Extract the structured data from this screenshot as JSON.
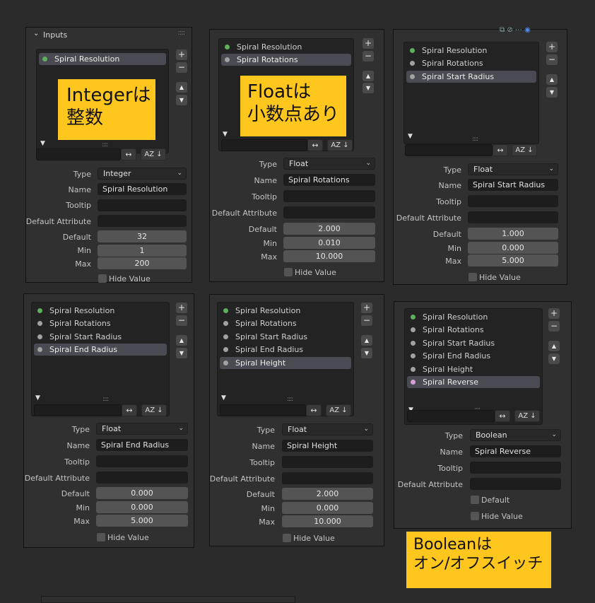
{
  "panels": [
    {
      "header_title": "Inputs",
      "items": [
        {
          "label": "Spiral Resolution",
          "dot": "green",
          "selected": true
        }
      ],
      "props": {
        "type_label": "Type",
        "type_value": "Integer",
        "name_label": "Name",
        "name_value": "Spiral Resolution",
        "tooltip_label": "Tooltip",
        "tooltip_value": "",
        "default_attr_label": "Default Attribute",
        "default_attr_value": "",
        "default_label": "Default",
        "default_value": "32",
        "min_label": "Min",
        "min_value": "1",
        "max_label": "Max",
        "max_value": "200",
        "hide_label": "Hide Value"
      },
      "note_lines": [
        "Integerは",
        "整数"
      ]
    },
    {
      "items": [
        {
          "label": "Spiral Resolution",
          "dot": "green",
          "selected": false
        },
        {
          "label": "Spiral Rotations",
          "dot": "gray",
          "selected": true
        }
      ],
      "props": {
        "type_label": "Type",
        "type_value": "Float",
        "name_label": "Name",
        "name_value": "Spiral Rotations",
        "tooltip_label": "Tooltip",
        "tooltip_value": "",
        "default_attr_label": "Default Attribute",
        "default_attr_value": "",
        "default_label": "Default",
        "default_value": "2.000",
        "min_label": "Min",
        "min_value": "0.010",
        "max_label": "Max",
        "max_value": "10.000",
        "hide_label": "Hide Value"
      },
      "note_lines": [
        "Floatは",
        "小数点あり"
      ]
    },
    {
      "items": [
        {
          "label": "Spiral Resolution",
          "dot": "green",
          "selected": false
        },
        {
          "label": "Spiral Rotations",
          "dot": "gray",
          "selected": false
        },
        {
          "label": "Spiral Start Radius",
          "dot": "gray",
          "selected": true
        }
      ],
      "props": {
        "type_label": "Type",
        "type_value": "Float",
        "name_label": "Name",
        "name_value": "Spiral Start Radius",
        "tooltip_label": "Tooltip",
        "tooltip_value": "",
        "default_attr_label": "Default Attribute",
        "default_attr_value": "",
        "default_label": "Default",
        "default_value": "1.000",
        "min_label": "Min",
        "min_value": "0.000",
        "max_label": "Max",
        "max_value": "5.000",
        "hide_label": "Hide Value"
      }
    },
    {
      "items": [
        {
          "label": "Spiral Resolution",
          "dot": "green",
          "selected": false
        },
        {
          "label": "Spiral Rotations",
          "dot": "gray",
          "selected": false
        },
        {
          "label": "Spiral Start Radius",
          "dot": "gray",
          "selected": false
        },
        {
          "label": "Spiral End Radius",
          "dot": "gray",
          "selected": true
        }
      ],
      "props": {
        "type_label": "Type",
        "type_value": "Float",
        "name_label": "Name",
        "name_value": "Spiral End Radius",
        "tooltip_label": "Tooltip",
        "tooltip_value": "",
        "default_attr_label": "Default Attribute",
        "default_attr_value": "",
        "default_label": "Default",
        "default_value": "0.000",
        "min_label": "Min",
        "min_value": "0.000",
        "max_label": "Max",
        "max_value": "5.000",
        "hide_label": "Hide Value"
      }
    },
    {
      "items": [
        {
          "label": "Spiral Resolution",
          "dot": "green",
          "selected": false
        },
        {
          "label": "Spiral Rotations",
          "dot": "gray",
          "selected": false
        },
        {
          "label": "Spiral Start Radius",
          "dot": "gray",
          "selected": false
        },
        {
          "label": "Spiral End Radius",
          "dot": "gray",
          "selected": false
        },
        {
          "label": "Spiral Height",
          "dot": "gray",
          "selected": true
        }
      ],
      "props": {
        "type_label": "Type",
        "type_value": "Float",
        "name_label": "Name",
        "name_value": "Spiral Height",
        "tooltip_label": "Tooltip",
        "tooltip_value": "",
        "default_attr_label": "Default Attribute",
        "default_attr_value": "",
        "default_label": "Default",
        "default_value": "2.000",
        "min_label": "Min",
        "min_value": "0.000",
        "max_label": "Max",
        "max_value": "10.000",
        "hide_label": "Hide Value"
      }
    },
    {
      "items": [
        {
          "label": "Spiral Resolution",
          "dot": "green",
          "selected": false
        },
        {
          "label": "Spiral Rotations",
          "dot": "gray",
          "selected": false
        },
        {
          "label": "Spiral Start Radius",
          "dot": "gray",
          "selected": false
        },
        {
          "label": "Spiral End Radius",
          "dot": "gray",
          "selected": false
        },
        {
          "label": "Spiral Height",
          "dot": "gray",
          "selected": false
        },
        {
          "label": "Spiral Reverse",
          "dot": "pink",
          "selected": true
        }
      ],
      "props": {
        "type_label": "Type",
        "type_value": "Boolean",
        "name_label": "Name",
        "name_value": "Spiral Reverse",
        "tooltip_label": "Tooltip",
        "tooltip_value": "",
        "default_attr_label": "Default Attribute",
        "default_attr_value": "",
        "default_check_label": "Default",
        "hide_label": "Hide Value"
      }
    }
  ],
  "bool_note_lines": [
    "Booleanは",
    "オン/オフスイッチ"
  ],
  "icons": {
    "add": "+",
    "remove": "−",
    "move_up": "▲",
    "move_down": "▼",
    "collapse": "▼",
    "grip": "::::",
    "swap": "↔",
    "sort_az": "AZ",
    "sort_dir": "↓",
    "chevron": "⌄"
  },
  "colors": {
    "panel_bg": "#303030",
    "list_bg": "#232323",
    "selected_row": "#4a4b52",
    "note_bg": "#ffc61e",
    "socket_int": "#5faf5f",
    "socket_float": "#a1a1a1",
    "socket_bool": "#d6a1d6"
  }
}
